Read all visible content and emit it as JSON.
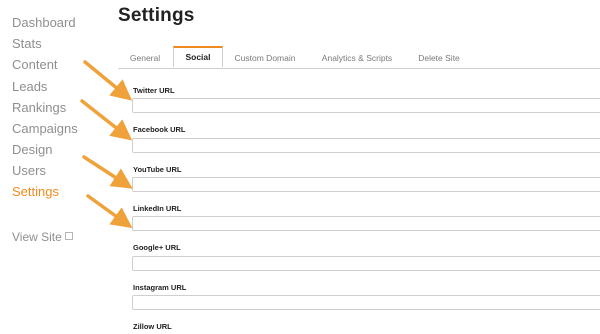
{
  "sidebar": {
    "items": [
      {
        "label": "Dashboard"
      },
      {
        "label": "Stats"
      },
      {
        "label": "Content"
      },
      {
        "label": "Leads"
      },
      {
        "label": "Rankings"
      },
      {
        "label": "Campaigns"
      },
      {
        "label": "Design"
      },
      {
        "label": "Users"
      },
      {
        "label": "Settings",
        "active": true
      }
    ],
    "view_site": "View Site"
  },
  "page": {
    "title": "Settings"
  },
  "tabs": [
    {
      "label": "General"
    },
    {
      "label": "Social",
      "active": true
    },
    {
      "label": "Custom Domain"
    },
    {
      "label": "Analytics & Scripts"
    },
    {
      "label": "Delete Site"
    }
  ],
  "fields": [
    {
      "label": "Twitter URL",
      "value": "",
      "placeholder": ""
    },
    {
      "label": "Facebook URL",
      "value": "",
      "placeholder": ""
    },
    {
      "label": "YouTube URL",
      "value": "",
      "placeholder": ""
    },
    {
      "label": "LinkedIn URL",
      "value": "",
      "placeholder": ""
    },
    {
      "label": "Google+ URL",
      "value": "",
      "placeholder": ""
    },
    {
      "label": "Instagram URL",
      "value": "",
      "placeholder": ""
    },
    {
      "label": "Zillow URL",
      "value": "",
      "placeholder": ""
    }
  ],
  "colors": {
    "accent": "#ef8a1f",
    "arrow": "#f0a23a"
  }
}
